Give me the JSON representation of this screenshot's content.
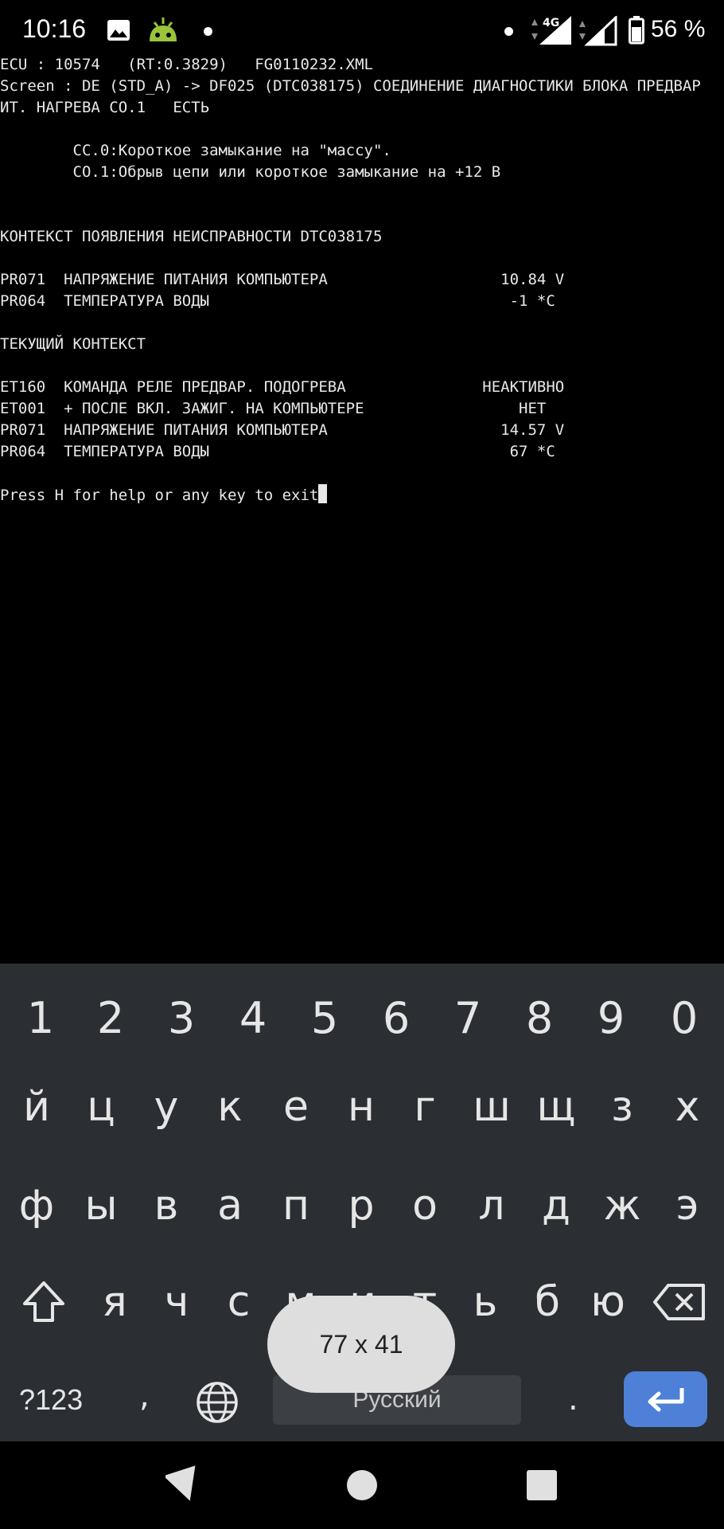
{
  "status_bar": {
    "time": "10:16",
    "network": "4G",
    "battery": "56 %"
  },
  "terminal": {
    "lines": [
      "ECU : 10574   (RT:0.3829)   FG0110232.XML",
      "Screen : DE (STD_A) -> DF025 (DTC038175) СОЕДИНЕНИЕ ДИАГНОСТИКИ БЛОКА ПРЕДВАР",
      "ИТ. НАГРЕВА СО.1   ЕСТЬ",
      "",
      "        CC.0:Короткое замыкание на \"массу\".",
      "        CO.1:Обрыв цепи или короткое замыкание на +12 В",
      "",
      "",
      "КОНТЕКСТ ПОЯВЛЕНИЯ НЕИСПРАВНОСТИ DTC038175",
      "",
      "PR071  НАПРЯЖЕНИЕ ПИТАНИЯ КОМПЬЮТЕРА                   10.84 V",
      "PR064  ТЕМПЕРАТУРА ВОДЫ                                 -1 *C",
      "",
      "ТЕКУЩИЙ КОНТЕКСТ",
      "",
      "ET160  КОМАНДА РЕЛЕ ПРЕДВАР. ПОДОГРЕВА               НЕАКТИВНО",
      "ET001  + ПОСЛЕ ВКЛ. ЗАЖИГ. НА КОМПЬЮТЕРЕ                 НЕТ",
      "PR071  НАПРЯЖЕНИЕ ПИТАНИЯ КОМПЬЮТЕРА                   14.57 V",
      "PR064  ТЕМПЕРАТУРА ВОДЫ                                 67 *C",
      "",
      "Press H for help or any key to exit"
    ]
  },
  "keyboard": {
    "row_numbers": [
      "1",
      "2",
      "3",
      "4",
      "5",
      "6",
      "7",
      "8",
      "9",
      "0"
    ],
    "row1": [
      "й",
      "ц",
      "у",
      "к",
      "е",
      "н",
      "г",
      "ш",
      "щ",
      "з",
      "х"
    ],
    "row2": [
      "ф",
      "ы",
      "в",
      "а",
      "п",
      "р",
      "о",
      "л",
      "д",
      "ж",
      "э"
    ],
    "row3": [
      "я",
      "ч",
      "с",
      "м",
      "и",
      "т",
      "ь",
      "б",
      "ю"
    ],
    "symbols_label": "?123",
    "comma": ",",
    "space_label": "Русский",
    "period": ".",
    "accent_color": "#4d80d6"
  },
  "toast": {
    "text": "77 x 41"
  }
}
